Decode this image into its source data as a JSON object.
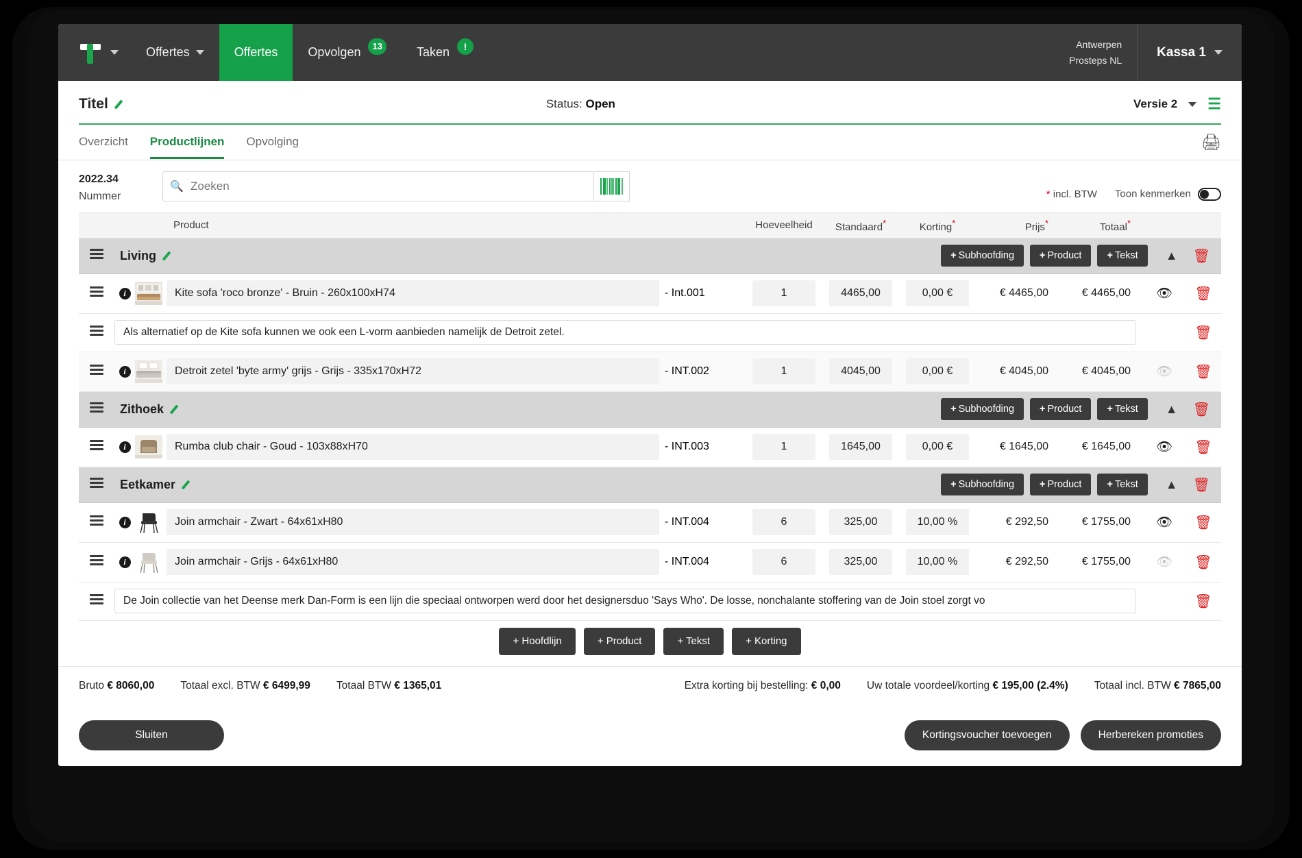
{
  "topnav": {
    "logo_name": "logo-t",
    "items": [
      {
        "label": "Offertes",
        "has_caret": true,
        "active": false
      },
      {
        "label": "Offertes",
        "has_caret": false,
        "active": true
      },
      {
        "label": "Opvolgen",
        "badge": "13",
        "active": false
      },
      {
        "label": "Taken",
        "badge": "!",
        "active": false
      }
    ],
    "org_line1": "Antwerpen",
    "org_line2": "Prosteps NL",
    "user": "Kassa 1"
  },
  "titlebar": {
    "title": "Titel",
    "status_label": "Status:",
    "status_value": "Open",
    "version": "Versie 2"
  },
  "tabs": [
    {
      "label": "Overzicht",
      "active": false
    },
    {
      "label": "Productlijnen",
      "active": true
    },
    {
      "label": "Opvolging",
      "active": false
    }
  ],
  "search": {
    "number": "2022.34",
    "number_label": "Nummer",
    "placeholder": "Zoeken",
    "value": ""
  },
  "meta": {
    "incl_btw": "incl. BTW",
    "toon_kenmerken": "Toon kenmerken"
  },
  "table": {
    "headers": {
      "product": "Product",
      "hoeveelheid": "Hoeveelheid",
      "standaard": "Standaard",
      "korting": "Korting",
      "prijs": "Prijs",
      "totaal": "Totaal"
    },
    "group_buttons": {
      "subhoofding": "Subhoofding",
      "product": "Product",
      "tekst": "Tekst"
    },
    "groups": [
      {
        "name": "Living",
        "rows": [
          {
            "type": "product",
            "name": "Kite sofa 'roco bronze' - Bruin - 260x100xH74",
            "code": "- Int.001",
            "qty": "1",
            "standaard": "4465,00",
            "korting": "0,00 €",
            "prijs": "€ 4465,00",
            "totaal": "€ 4465,00",
            "eye_active": true,
            "thumb": "sofa-light"
          },
          {
            "type": "text",
            "text": "Als alternatief op de Kite sofa kunnen we ook een L-vorm aanbieden namelijk de Detroit zetel."
          },
          {
            "type": "product",
            "name": "Detroit zetel 'byte army' grijs - Grijs - 335x170xH72",
            "code": "- INT.002",
            "qty": "1",
            "standaard": "4045,00",
            "korting": "0,00 €",
            "prijs": "€ 4045,00",
            "totaal": "€ 4045,00",
            "eye_active": false,
            "thumb": "sofa-grey"
          }
        ]
      },
      {
        "name": "Zithoek",
        "rows": [
          {
            "type": "product",
            "name": "Rumba club chair - Goud - 103x88xH70",
            "code": "- INT.003",
            "qty": "1",
            "standaard": "1645,00",
            "korting": "0,00 €",
            "prijs": "€ 1645,00",
            "totaal": "€ 1645,00",
            "eye_active": true,
            "thumb": "club-chair"
          }
        ]
      },
      {
        "name": "Eetkamer",
        "rows": [
          {
            "type": "product",
            "name": "Join armchair - Zwart - 64x61xH80",
            "code": "- INT.004",
            "qty": "6",
            "standaard": "325,00",
            "korting": "10,00 %",
            "prijs": "€ 292,50",
            "totaal": "€ 1755,00",
            "eye_active": true,
            "thumb": "chair-black"
          },
          {
            "type": "product",
            "name": "Join armchair - Grijs - 64x61xH80",
            "code": "- INT.004",
            "qty": "6",
            "standaard": "325,00",
            "korting": "10,00 %",
            "prijs": "€ 292,50",
            "totaal": "€ 1755,00",
            "eye_active": false,
            "thumb": "chair-grey"
          },
          {
            "type": "text",
            "text": "De Join collectie van het Deense merk Dan-Form is een lijn die speciaal ontworpen werd door het designersduo 'Says Who'. De losse, nonchalante stoffering van de Join stoel zorgt vo"
          }
        ]
      }
    ],
    "add_buttons": [
      "+ Hoofdlijn",
      "+ Product",
      "+ Tekst",
      "+ Korting"
    ]
  },
  "totals": {
    "bruto_label": "Bruto",
    "bruto_value": "€ 8060,00",
    "excl_label": "Totaal excl. BTW",
    "excl_value": "€ 6499,99",
    "btw_label": "Totaal BTW",
    "btw_value": "€ 1365,01",
    "extra_label": "Extra korting bij bestelling:",
    "extra_value": "€ 0,00",
    "voordeel_label": "Uw totale voordeel/korting",
    "voordeel_value": "€ 195,00 (2.4%)",
    "incl_label": "Totaal incl. BTW",
    "incl_value": "€ 7865,00"
  },
  "footer": {
    "sluiten": "Sluiten",
    "voucher": "Kortingsvoucher toevoegen",
    "herbereken": "Herbereken promoties"
  },
  "colors": {
    "brand_green": "#15a04a",
    "nav_dark": "#3b3b3b",
    "danger_red": "#e02020",
    "group_grey": "#d6d6d6"
  }
}
